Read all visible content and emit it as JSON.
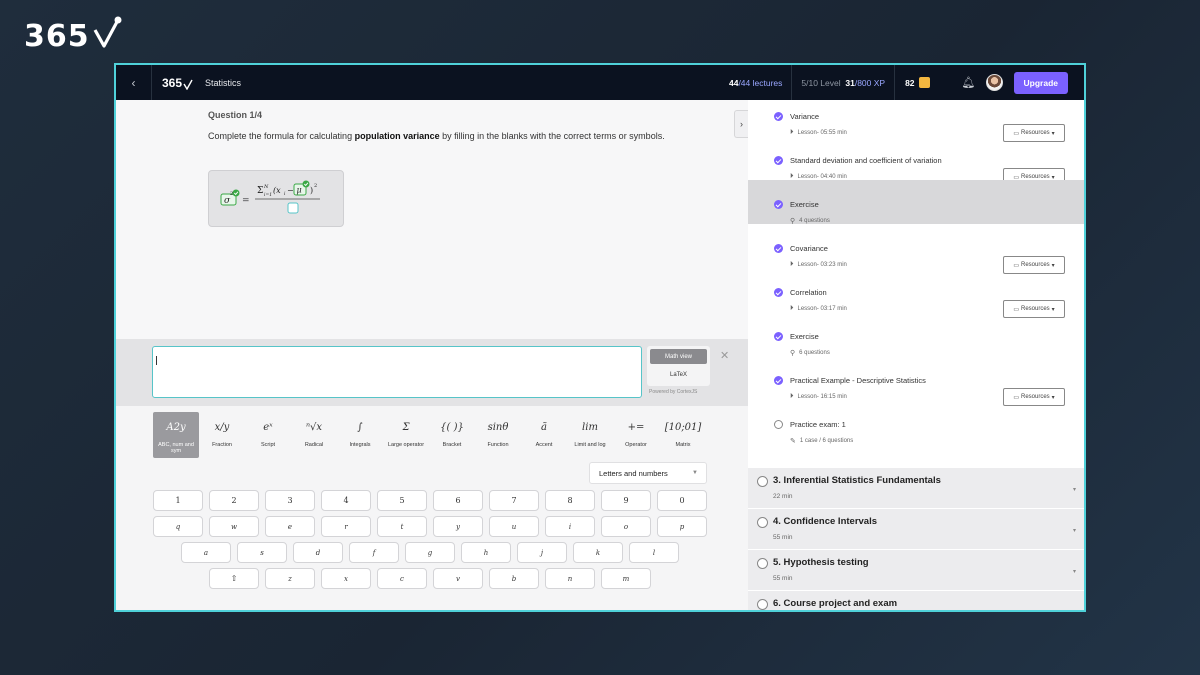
{
  "brand": {
    "logo_text": "365"
  },
  "topbar": {
    "back_icon": "chevron-left-icon",
    "logo_text": "365",
    "course_title": "Statistics",
    "lectures_done": "44",
    "lectures_total": "/44 lectures",
    "level": "5/10 Level",
    "xp_current": "31",
    "xp_total": "/800 XP",
    "coins": "82",
    "upgrade_label": "Upgrade",
    "accent_color": "#7b61ff"
  },
  "question": {
    "label": "Question 1/4",
    "text_before": "Complete the formula for calculating ",
    "text_bold": "population variance",
    "text_after": " by filling in the blanks with the correct terms or symbols."
  },
  "input": {
    "math_view_label": "Math view",
    "latex_label": "LaTeX",
    "powered_by": "Powered by CortexJS"
  },
  "keyboard": {
    "categories": [
      {
        "sym": "A2y",
        "label": "ABC, num and sym"
      },
      {
        "sym": "x/y",
        "label": "Fraction"
      },
      {
        "sym": "eˣ",
        "label": "Script"
      },
      {
        "sym": "ⁿ√x",
        "label": "Radical"
      },
      {
        "sym": "∫",
        "label": "Integrals"
      },
      {
        "sym": "Σ",
        "label": "Large operator"
      },
      {
        "sym": "{( )}",
        "label": "Bracket"
      },
      {
        "sym": "sinθ",
        "label": "Function"
      },
      {
        "sym": "ã",
        "label": "Accent"
      },
      {
        "sym": "lim",
        "label": "Limit and log"
      },
      {
        "sym": "+=",
        "label": "Operator"
      },
      {
        "sym": "[10;01]",
        "label": "Matrix"
      }
    ],
    "mode_select": "Letters and numbers",
    "row1": [
      "1",
      "2",
      "3",
      "4",
      "5",
      "6",
      "7",
      "8",
      "9",
      "0"
    ],
    "row2": [
      "q",
      "w",
      "e",
      "r",
      "t",
      "y",
      "u",
      "i",
      "o",
      "p"
    ],
    "row3": [
      "a",
      "s",
      "d",
      "f",
      "g",
      "h",
      "j",
      "k",
      "l"
    ],
    "row4": [
      "⇧",
      "z",
      "x",
      "c",
      "v",
      "b",
      "n",
      "m"
    ]
  },
  "lessons": [
    {
      "title": "Variance",
      "meta": "Lesson- 05:55 min",
      "type": "video",
      "resources": "Resources"
    },
    {
      "title": "Standard deviation and coefficient of variation",
      "meta": "Lesson- 04:40 min",
      "type": "video",
      "resources": "Resources"
    },
    {
      "title": "Exercise",
      "meta": "4 questions",
      "type": "exercise",
      "resources": ""
    },
    {
      "title": "Covariance",
      "meta": "Lesson- 03:23 min",
      "type": "video",
      "resources": "Resources"
    },
    {
      "title": "Correlation",
      "meta": "Lesson- 03:17 min",
      "type": "video",
      "resources": "Resources"
    },
    {
      "title": "Exercise",
      "meta": "6 questions",
      "type": "exercise",
      "resources": ""
    },
    {
      "title": "Practical Example - Descriptive Statistics",
      "meta": "Lesson- 16:15 min",
      "type": "video",
      "resources": "Resources"
    },
    {
      "title": "Practice exam: 1",
      "meta": "1 case / 6 questions",
      "type": "exam",
      "resources": ""
    }
  ],
  "sections": [
    {
      "title": "3. Inferential Statistics Fundamentals",
      "duration": "22 min"
    },
    {
      "title": "4. Confidence Intervals",
      "duration": "55 min"
    },
    {
      "title": "5. Hypothesis testing",
      "duration": "55 min"
    },
    {
      "title": "6. Course project and exam",
      "duration": ""
    }
  ]
}
